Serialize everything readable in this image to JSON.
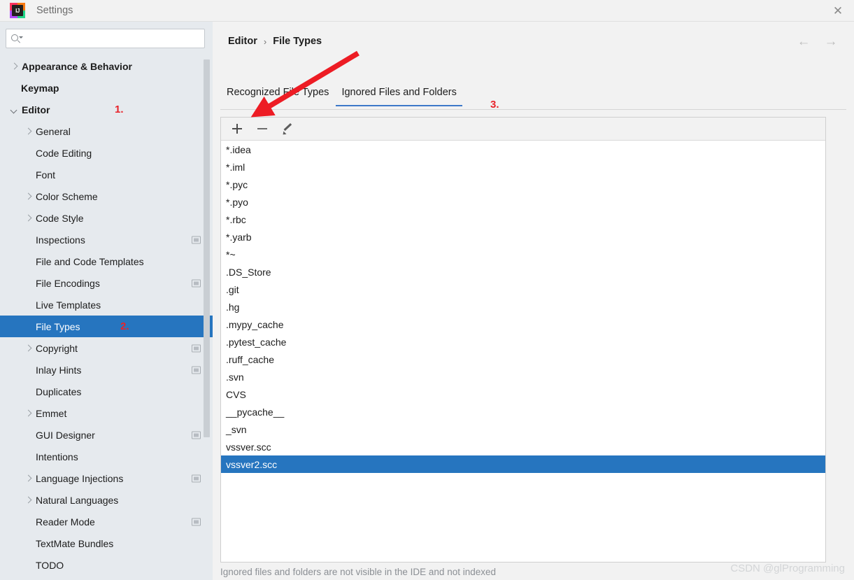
{
  "window": {
    "title": "Settings",
    "logo_text": "IJ",
    "close_label": "✕"
  },
  "search": {
    "value": "",
    "placeholder": ""
  },
  "sidebar": {
    "items": [
      {
        "label": "Appearance & Behavior",
        "indent": 16,
        "arrow": "closed",
        "bold": true,
        "selected": false,
        "mark": false
      },
      {
        "label": "Keymap",
        "indent": 30,
        "arrow": "none",
        "bold": true,
        "selected": false,
        "mark": false
      },
      {
        "label": "Editor",
        "indent": 16,
        "arrow": "open",
        "bold": true,
        "selected": false,
        "mark": false,
        "annot": "1."
      },
      {
        "label": "General",
        "indent": 36,
        "arrow": "closed",
        "bold": false,
        "selected": false,
        "mark": false
      },
      {
        "label": "Code Editing",
        "indent": 51,
        "arrow": "none",
        "bold": false,
        "selected": false,
        "mark": false
      },
      {
        "label": "Font",
        "indent": 51,
        "arrow": "none",
        "bold": false,
        "selected": false,
        "mark": false
      },
      {
        "label": "Color Scheme",
        "indent": 36,
        "arrow": "closed",
        "bold": false,
        "selected": false,
        "mark": false
      },
      {
        "label": "Code Style",
        "indent": 36,
        "arrow": "closed",
        "bold": false,
        "selected": false,
        "mark": false
      },
      {
        "label": "Inspections",
        "indent": 51,
        "arrow": "none",
        "bold": false,
        "selected": false,
        "mark": true
      },
      {
        "label": "File and Code Templates",
        "indent": 51,
        "arrow": "none",
        "bold": false,
        "selected": false,
        "mark": false
      },
      {
        "label": "File Encodings",
        "indent": 51,
        "arrow": "none",
        "bold": false,
        "selected": false,
        "mark": true
      },
      {
        "label": "Live Templates",
        "indent": 51,
        "arrow": "none",
        "bold": false,
        "selected": false,
        "mark": false
      },
      {
        "label": "File Types",
        "indent": 51,
        "arrow": "none",
        "bold": false,
        "selected": true,
        "mark": false,
        "annot": "2."
      },
      {
        "label": "Copyright",
        "indent": 36,
        "arrow": "closed",
        "bold": false,
        "selected": false,
        "mark": true
      },
      {
        "label": "Inlay Hints",
        "indent": 51,
        "arrow": "none",
        "bold": false,
        "selected": false,
        "mark": true
      },
      {
        "label": "Duplicates",
        "indent": 51,
        "arrow": "none",
        "bold": false,
        "selected": false,
        "mark": false
      },
      {
        "label": "Emmet",
        "indent": 36,
        "arrow": "closed",
        "bold": false,
        "selected": false,
        "mark": false
      },
      {
        "label": "GUI Designer",
        "indent": 51,
        "arrow": "none",
        "bold": false,
        "selected": false,
        "mark": true
      },
      {
        "label": "Intentions",
        "indent": 51,
        "arrow": "none",
        "bold": false,
        "selected": false,
        "mark": false
      },
      {
        "label": "Language Injections",
        "indent": 36,
        "arrow": "closed",
        "bold": false,
        "selected": false,
        "mark": true
      },
      {
        "label": "Natural Languages",
        "indent": 36,
        "arrow": "closed",
        "bold": false,
        "selected": false,
        "mark": false
      },
      {
        "label": "Reader Mode",
        "indent": 51,
        "arrow": "none",
        "bold": false,
        "selected": false,
        "mark": true
      },
      {
        "label": "TextMate Bundles",
        "indent": 51,
        "arrow": "none",
        "bold": false,
        "selected": false,
        "mark": false
      },
      {
        "label": "TODO",
        "indent": 51,
        "arrow": "none",
        "bold": false,
        "selected": false,
        "mark": false
      }
    ]
  },
  "main": {
    "breadcrumb": {
      "root": "Editor",
      "separator": "›",
      "leaf": "File Types"
    },
    "nav": {
      "back": "←",
      "forward": "→"
    },
    "tabs": [
      {
        "label": "Recognized File Types",
        "active": false
      },
      {
        "label": "Ignored Files and Folders",
        "active": true
      }
    ],
    "tab_annotation": "3.",
    "toolbar": {
      "add_label": "Add",
      "remove_label": "Remove",
      "edit_label": "Edit"
    },
    "ignored_entries": [
      {
        "name": "*.idea",
        "selected": false
      },
      {
        "name": "*.iml",
        "selected": false
      },
      {
        "name": "*.pyc",
        "selected": false
      },
      {
        "name": "*.pyo",
        "selected": false
      },
      {
        "name": "*.rbc",
        "selected": false
      },
      {
        "name": "*.yarb",
        "selected": false
      },
      {
        "name": "*~",
        "selected": false
      },
      {
        "name": ".DS_Store",
        "selected": false
      },
      {
        "name": ".git",
        "selected": false
      },
      {
        "name": ".hg",
        "selected": false
      },
      {
        "name": ".mypy_cache",
        "selected": false
      },
      {
        "name": ".pytest_cache",
        "selected": false
      },
      {
        "name": ".ruff_cache",
        "selected": false
      },
      {
        "name": ".svn",
        "selected": false
      },
      {
        "name": "CVS",
        "selected": false
      },
      {
        "name": "__pycache__",
        "selected": false
      },
      {
        "name": "_svn",
        "selected": false
      },
      {
        "name": "vssver.scc",
        "selected": false
      },
      {
        "name": "vssver2.scc",
        "selected": true
      }
    ],
    "hint": "Ignored files and folders are not visible in the IDE and not indexed"
  },
  "watermark": "CSDN @glProgramming",
  "colors": {
    "selection": "#2675bf",
    "tab_underline": "#3d78c8",
    "annotation_red": "#e8232a",
    "sidebar_bg": "#e6eaee"
  }
}
